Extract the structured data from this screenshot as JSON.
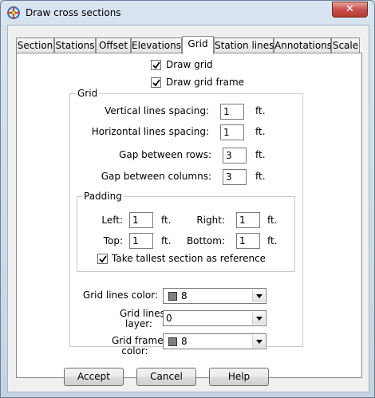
{
  "window": {
    "title": "Draw cross sections",
    "close_glyph": "✕"
  },
  "tabs": [
    {
      "label": "Section"
    },
    {
      "label": "Stations"
    },
    {
      "label": "Offset"
    },
    {
      "label": "Elevations"
    },
    {
      "label": "Grid",
      "active": true
    },
    {
      "label": "Station lines"
    },
    {
      "label": "Annotations"
    },
    {
      "label": "Scale"
    }
  ],
  "grid_tab": {
    "draw_grid": {
      "label": "Draw grid",
      "checked": true
    },
    "draw_grid_frame": {
      "label": "Draw grid frame",
      "checked": true
    },
    "grid_group": {
      "legend": "Grid",
      "vertical_spacing": {
        "label": "Vertical lines spacing:",
        "value": "1",
        "unit": "ft."
      },
      "horizontal_spacing": {
        "label": "Horizontal lines spacing:",
        "value": "1",
        "unit": "ft."
      },
      "gap_rows": {
        "label": "Gap between rows:",
        "value": "3",
        "unit": "ft."
      },
      "gap_columns": {
        "label": "Gap between columns:",
        "value": "3",
        "unit": "ft."
      },
      "padding": {
        "legend": "Padding",
        "left": {
          "label": "Left:",
          "value": "1",
          "unit": "ft."
        },
        "right": {
          "label": "Right:",
          "value": "1",
          "unit": "ft."
        },
        "top": {
          "label": "Top:",
          "value": "1",
          "unit": "ft."
        },
        "bottom": {
          "label": "Bottom:",
          "value": "1",
          "unit": "ft."
        },
        "tallest_reference": {
          "label": "Take tallest section as reference",
          "checked": true
        }
      },
      "grid_lines_color": {
        "label": "Grid lines color:",
        "value": "8",
        "swatch": "#808080"
      },
      "grid_lines_layer": {
        "label_line1": "Grid lines",
        "label_line2": "layer:",
        "value": "0"
      },
      "grid_frame_color": {
        "label_line1": "Grid frame",
        "label_line2": "color:",
        "value": "8",
        "swatch": "#808080"
      }
    }
  },
  "buttons": {
    "accept": "Accept",
    "cancel": "Cancel",
    "help": "Help"
  },
  "colors": {
    "accent": "#2e6fb8",
    "close": "#c75050"
  }
}
